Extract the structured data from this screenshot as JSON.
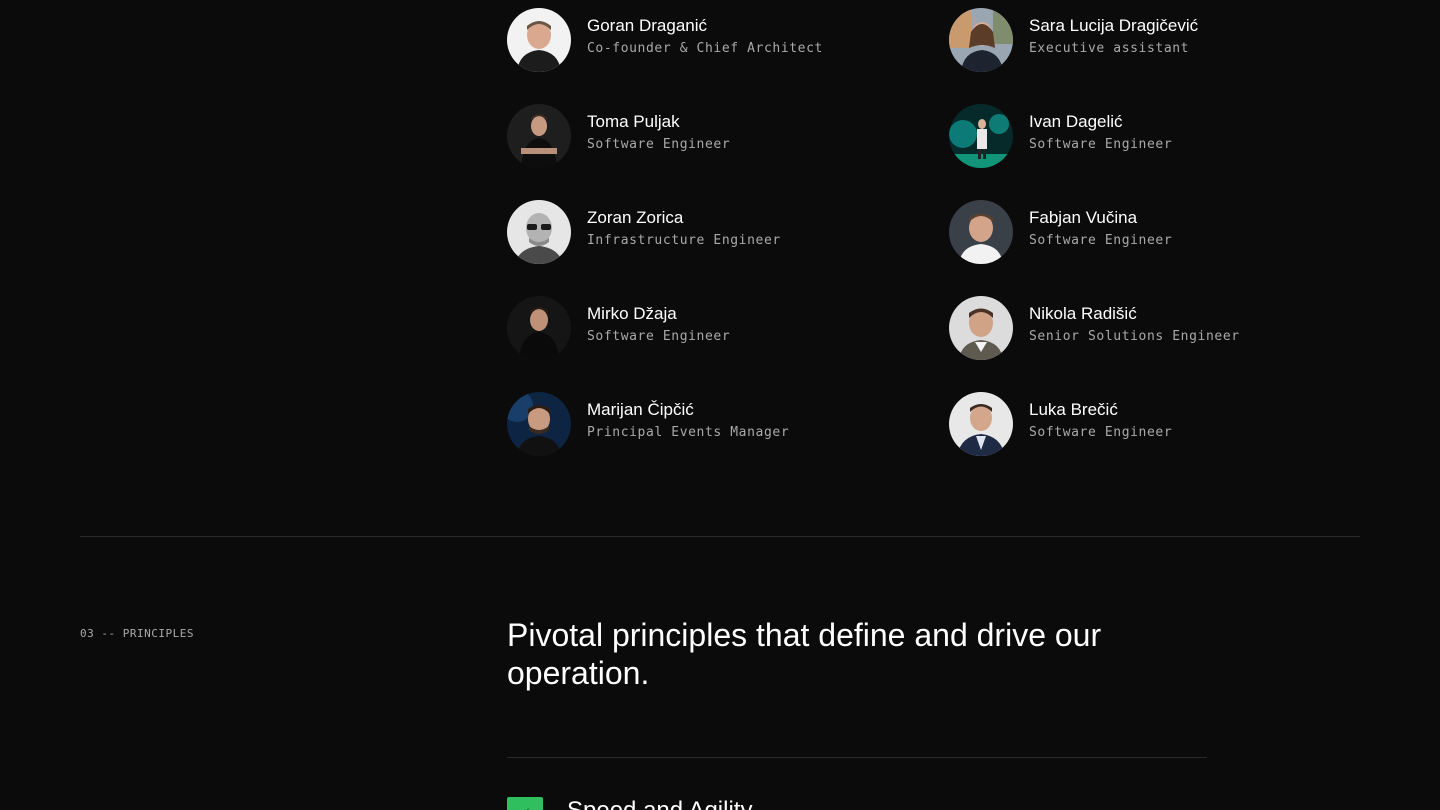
{
  "team": {
    "members": [
      {
        "name": "Goran Draganić",
        "role": "Co-founder & Chief Architect",
        "avatar": "portrait-light-bg"
      },
      {
        "name": "Sara Lucija Dragičević",
        "role": "Executive assistant",
        "avatar": "portrait-outdoor"
      },
      {
        "name": "Toma Puljak",
        "role": "Software Engineer",
        "avatar": "portrait-dark"
      },
      {
        "name": "Ivan Dagelić",
        "role": "Software Engineer",
        "avatar": "portrait-stage-teal"
      },
      {
        "name": "Zoran Zorica",
        "role": "Infrastructure Engineer",
        "avatar": "portrait-grayscale-sunglasses"
      },
      {
        "name": "Fabjan Vučina",
        "role": "Software Engineer",
        "avatar": "portrait-gray-bg"
      },
      {
        "name": "Mirko Džaja",
        "role": "Software Engineer",
        "avatar": "portrait-dark"
      },
      {
        "name": "Nikola Radišić",
        "role": "Senior Solutions Engineer",
        "avatar": "portrait-light-checked-shirt"
      },
      {
        "name": "Marijan Čipčić",
        "role": "Principal Events Manager",
        "avatar": "portrait-blue-bg"
      },
      {
        "name": "Luka Brečić",
        "role": "Software Engineer",
        "avatar": "portrait-suit"
      }
    ]
  },
  "principles": {
    "label": "03 -- PRINCIPLES",
    "heading": "Pivotal principles that define and drive our operation.",
    "items": [
      {
        "title": "Speed and Agility",
        "icon": "lightning-icon"
      }
    ]
  },
  "colors": {
    "background": "#0b0b0b",
    "text": "#ffffff",
    "muted": "#a9a9a9",
    "divider": "#2a2a2a",
    "accent": "#2fbf5f"
  }
}
